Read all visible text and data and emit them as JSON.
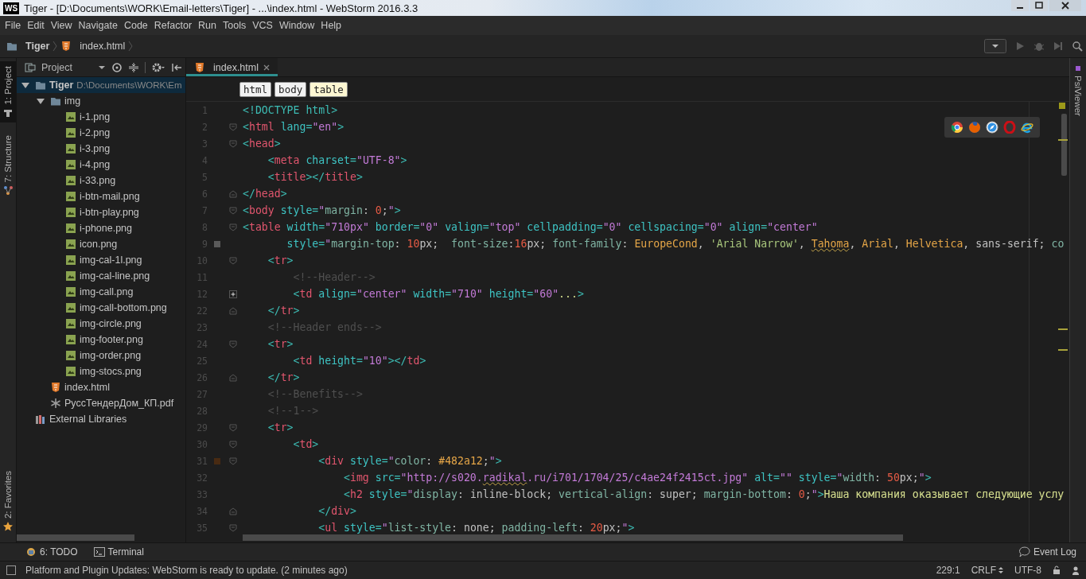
{
  "window": {
    "title": "Tiger - [D:\\Documents\\WORK\\Email-letters\\Tiger] - ...\\index.html - WebStorm 2016.3.3",
    "badge": "WS"
  },
  "menu": [
    "File",
    "Edit",
    "View",
    "Navigate",
    "Code",
    "Refactor",
    "Run",
    "Tools",
    "VCS",
    "Window",
    "Help"
  ],
  "navigation": {
    "breadcrumbs": [
      {
        "label": "Tiger",
        "kind": "folder"
      },
      {
        "label": "index.html",
        "kind": "html"
      }
    ]
  },
  "left_tool_strip": {
    "top": [
      {
        "label": "1: Project",
        "kind": "project",
        "selected": true
      },
      {
        "label": "7: Structure",
        "kind": "structure",
        "selected": false
      }
    ],
    "bottom": [
      {
        "label": "2: Favorites",
        "kind": "favorites",
        "selected": false
      }
    ]
  },
  "project_panel": {
    "title": "Project",
    "tree": [
      {
        "label": "Tiger",
        "kind": "project",
        "path": "D:\\Documents\\WORK\\Em",
        "expanded": true,
        "selected": true,
        "children": [
          {
            "label": "img",
            "kind": "folder",
            "expanded": true,
            "selected": false,
            "children": [
              {
                "label": "i-1.png",
                "kind": "image",
                "selected": false
              },
              {
                "label": "i-2.png",
                "kind": "image",
                "selected": false
              },
              {
                "label": "i-3.png",
                "kind": "image",
                "selected": false
              },
              {
                "label": "i-4.png",
                "kind": "image",
                "selected": false
              },
              {
                "label": "i-33.png",
                "kind": "image",
                "selected": false
              },
              {
                "label": "i-btn-mail.png",
                "kind": "image",
                "selected": false
              },
              {
                "label": "i-btn-play.png",
                "kind": "image",
                "selected": false
              },
              {
                "label": "i-phone.png",
                "kind": "image",
                "selected": false
              },
              {
                "label": "icon.png",
                "kind": "image",
                "selected": false
              },
              {
                "label": "img-cal-1l.png",
                "kind": "image",
                "selected": false
              },
              {
                "label": "img-cal-line.png",
                "kind": "image",
                "selected": false
              },
              {
                "label": "img-call.png",
                "kind": "image",
                "selected": false
              },
              {
                "label": "img-call-bottom.png",
                "kind": "image",
                "selected": false
              },
              {
                "label": "img-circle.png",
                "kind": "image",
                "selected": false
              },
              {
                "label": "img-footer.png",
                "kind": "image",
                "selected": false
              },
              {
                "label": "img-order.png",
                "kind": "image",
                "selected": false
              },
              {
                "label": "img-stocs.png",
                "kind": "image",
                "selected": false
              }
            ]
          },
          {
            "label": "index.html",
            "kind": "html",
            "selected": false
          },
          {
            "label": "РуссТендерДом_КП.pdf",
            "kind": "pdf",
            "selected": false
          }
        ]
      },
      {
        "label": "External Libraries",
        "kind": "library",
        "selected": false
      }
    ]
  },
  "editor": {
    "tabs": [
      {
        "label": "index.html",
        "kind": "html",
        "selected": true
      }
    ],
    "breadcrumbs": [
      {
        "label": "html",
        "selected": false
      },
      {
        "label": "body",
        "selected": false
      },
      {
        "label": "table",
        "selected": true
      }
    ],
    "lines": [
      {
        "number": "1",
        "tokens": [
          {
            "kind": "p",
            "text": "<!DOCTYPE html>"
          }
        ]
      },
      {
        "number": "2",
        "fold": {
          "kind": "open"
        },
        "tokens": [
          {
            "kind": "p",
            "text": "<"
          },
          {
            "kind": "t",
            "text": "html"
          },
          {
            "kind": "a",
            "text": " lang"
          },
          {
            "kind": "p",
            "text": "="
          },
          {
            "kind": "v",
            "text": "\"en\""
          },
          {
            "kind": "p",
            "text": ">"
          }
        ]
      },
      {
        "number": "3",
        "fold": {
          "kind": "open"
        },
        "tokens": [
          {
            "kind": "p",
            "text": "<"
          },
          {
            "kind": "t",
            "text": "head"
          },
          {
            "kind": "p",
            "text": ">"
          }
        ]
      },
      {
        "number": "4",
        "tokens": [
          {
            "kind": "p",
            "text": "    <"
          },
          {
            "kind": "t",
            "text": "meta"
          },
          {
            "kind": "a",
            "text": " charset"
          },
          {
            "kind": "p",
            "text": "="
          },
          {
            "kind": "v",
            "text": "\"UTF-8\""
          },
          {
            "kind": "p",
            "text": ">"
          }
        ]
      },
      {
        "number": "5",
        "tokens": [
          {
            "kind": "p",
            "text": "    <"
          },
          {
            "kind": "t",
            "text": "title"
          },
          {
            "kind": "p",
            "text": "></"
          },
          {
            "kind": "t",
            "text": "title"
          },
          {
            "kind": "p",
            "text": ">"
          }
        ]
      },
      {
        "number": "6",
        "fold": {
          "kind": "close"
        },
        "tokens": [
          {
            "kind": "p",
            "text": "</"
          },
          {
            "kind": "t",
            "text": "head"
          },
          {
            "kind": "p",
            "text": ">"
          }
        ]
      },
      {
        "number": "7",
        "fold": {
          "kind": "open"
        },
        "tokens": [
          {
            "kind": "p",
            "text": "<"
          },
          {
            "kind": "t",
            "text": "body"
          },
          {
            "kind": "a",
            "text": " style"
          },
          {
            "kind": "p",
            "text": "="
          },
          {
            "kind": "v",
            "text": "\""
          },
          {
            "kind": "k",
            "text": "margin"
          },
          {
            "kind": "x",
            "text": ": "
          },
          {
            "kind": "n",
            "text": "0"
          },
          {
            "kind": "x",
            "text": ";"
          },
          {
            "kind": "v",
            "text": "\""
          },
          {
            "kind": "p",
            "text": ">"
          }
        ]
      },
      {
        "number": "8",
        "fold": {
          "kind": "open"
        },
        "tokens": [
          {
            "kind": "p",
            "text": "<"
          },
          {
            "kind": "t",
            "text": "table"
          },
          {
            "kind": "a",
            "text": " width"
          },
          {
            "kind": "p",
            "text": "="
          },
          {
            "kind": "v",
            "text": "\"710px\""
          },
          {
            "kind": "a",
            "text": " border"
          },
          {
            "kind": "p",
            "text": "="
          },
          {
            "kind": "v",
            "text": "\"0\""
          },
          {
            "kind": "a",
            "text": " valign"
          },
          {
            "kind": "p",
            "text": "="
          },
          {
            "kind": "v",
            "text": "\"top\""
          },
          {
            "kind": "a",
            "text": " cellpadding"
          },
          {
            "kind": "p",
            "text": "="
          },
          {
            "kind": "v",
            "text": "\"0\""
          },
          {
            "kind": "a",
            "text": " cellspacing"
          },
          {
            "kind": "p",
            "text": "="
          },
          {
            "kind": "v",
            "text": "\"0\""
          },
          {
            "kind": "a",
            "text": " align"
          },
          {
            "kind": "p",
            "text": "="
          },
          {
            "kind": "v",
            "text": "\"center\""
          }
        ]
      },
      {
        "number": "9",
        "color": "#5a5a5a",
        "tokens": [
          {
            "kind": "a",
            "text": "       style"
          },
          {
            "kind": "p",
            "text": "="
          },
          {
            "kind": "v",
            "text": "\""
          },
          {
            "kind": "k",
            "text": "margin-top"
          },
          {
            "kind": "x",
            "text": ": "
          },
          {
            "kind": "n",
            "text": "10"
          },
          {
            "kind": "x",
            "text": "px;  "
          },
          {
            "kind": "k",
            "text": "font-size"
          },
          {
            "kind": "x",
            "text": ":"
          },
          {
            "kind": "n",
            "text": "16"
          },
          {
            "kind": "x",
            "text": "px; "
          },
          {
            "kind": "k",
            "text": "font-family"
          },
          {
            "kind": "x",
            "text": ": "
          },
          {
            "kind": "f",
            "text": "EuropeCond"
          },
          {
            "kind": "x",
            "text": ", "
          },
          {
            "kind": "s",
            "text": "'Arial Narrow'"
          },
          {
            "kind": "x",
            "text": ", "
          },
          {
            "kind": "w",
            "text": "Tahoma"
          },
          {
            "kind": "x",
            "text": ", "
          },
          {
            "kind": "f",
            "text": "Arial"
          },
          {
            "kind": "x",
            "text": ", "
          },
          {
            "kind": "f",
            "text": "Helvetica"
          },
          {
            "kind": "x",
            "text": ", sans-serif; "
          },
          {
            "kind": "k",
            "text": "co"
          }
        ]
      },
      {
        "number": "10",
        "fold": {
          "kind": "open"
        },
        "tokens": [
          {
            "kind": "p",
            "text": "    <"
          },
          {
            "kind": "t",
            "text": "tr"
          },
          {
            "kind": "p",
            "text": ">"
          }
        ]
      },
      {
        "number": "11",
        "tokens": [
          {
            "kind": "c",
            "text": "        <!--Header-->"
          }
        ]
      },
      {
        "number": "12",
        "fold": {
          "kind": "collapsed"
        },
        "tokens": [
          {
            "kind": "p",
            "text": "        <"
          },
          {
            "kind": "t",
            "text": "td"
          },
          {
            "kind": "a",
            "text": " align"
          },
          {
            "kind": "p",
            "text": "="
          },
          {
            "kind": "v",
            "text": "\"center\""
          },
          {
            "kind": "a",
            "text": " width"
          },
          {
            "kind": "p",
            "text": "="
          },
          {
            "kind": "v",
            "text": "\"710\""
          },
          {
            "kind": "a",
            "text": " height"
          },
          {
            "kind": "p",
            "text": "="
          },
          {
            "kind": "v",
            "text": "\"60\""
          },
          {
            "kind": "y",
            "text": "..."
          },
          {
            "kind": "p",
            "text": ">"
          }
        ]
      },
      {
        "number": "22",
        "fold": {
          "kind": "close"
        },
        "tokens": [
          {
            "kind": "p",
            "text": "    </"
          },
          {
            "kind": "t",
            "text": "tr"
          },
          {
            "kind": "p",
            "text": ">"
          }
        ]
      },
      {
        "number": "23",
        "tokens": [
          {
            "kind": "c",
            "text": "    <!--Header ends-->"
          }
        ]
      },
      {
        "number": "24",
        "fold": {
          "kind": "open"
        },
        "tokens": [
          {
            "kind": "p",
            "text": "    <"
          },
          {
            "kind": "t",
            "text": "tr"
          },
          {
            "kind": "p",
            "text": ">"
          }
        ]
      },
      {
        "number": "25",
        "tokens": [
          {
            "kind": "p",
            "text": "        <"
          },
          {
            "kind": "t",
            "text": "td"
          },
          {
            "kind": "a",
            "text": " height"
          },
          {
            "kind": "p",
            "text": "="
          },
          {
            "kind": "v",
            "text": "\"10\""
          },
          {
            "kind": "p",
            "text": "></"
          },
          {
            "kind": "t",
            "text": "td"
          },
          {
            "kind": "p",
            "text": ">"
          }
        ]
      },
      {
        "number": "26",
        "fold": {
          "kind": "close"
        },
        "tokens": [
          {
            "kind": "p",
            "text": "    </"
          },
          {
            "kind": "t",
            "text": "tr"
          },
          {
            "kind": "p",
            "text": ">"
          }
        ]
      },
      {
        "number": "27",
        "tokens": [
          {
            "kind": "c",
            "text": "    <!--Benefits-->"
          }
        ]
      },
      {
        "number": "28",
        "tokens": [
          {
            "kind": "c",
            "text": "    <!--1-->"
          }
        ]
      },
      {
        "number": "29",
        "fold": {
          "kind": "open"
        },
        "tokens": [
          {
            "kind": "p",
            "text": "    <"
          },
          {
            "kind": "t",
            "text": "tr"
          },
          {
            "kind": "p",
            "text": ">"
          }
        ]
      },
      {
        "number": "30",
        "fold": {
          "kind": "open"
        },
        "tokens": [
          {
            "kind": "p",
            "text": "        <"
          },
          {
            "kind": "t",
            "text": "td"
          },
          {
            "kind": "p",
            "text": ">"
          }
        ]
      },
      {
        "number": "31",
        "fold": {
          "kind": "open"
        },
        "color": "#482a12",
        "tokens": [
          {
            "kind": "p",
            "text": "            <"
          },
          {
            "kind": "t",
            "text": "div"
          },
          {
            "kind": "a",
            "text": " style"
          },
          {
            "kind": "p",
            "text": "="
          },
          {
            "kind": "v",
            "text": "\""
          },
          {
            "kind": "k",
            "text": "color"
          },
          {
            "kind": "x",
            "text": ": "
          },
          {
            "kind": "f",
            "text": "#482a12"
          },
          {
            "kind": "x",
            "text": ";"
          },
          {
            "kind": "v",
            "text": "\""
          },
          {
            "kind": "p",
            "text": ">"
          }
        ]
      },
      {
        "number": "32",
        "tokens": [
          {
            "kind": "p",
            "text": "                <"
          },
          {
            "kind": "t",
            "text": "img"
          },
          {
            "kind": "a",
            "text": " src"
          },
          {
            "kind": "p",
            "text": "="
          },
          {
            "kind": "v",
            "text": "\"http://s020."
          },
          {
            "kind": "u",
            "text": "radikal"
          },
          {
            "kind": "v",
            "text": ".ru/i701/1704/25/c4ae24f2415ct.jpg\""
          },
          {
            "kind": "a",
            "text": " alt"
          },
          {
            "kind": "p",
            "text": "="
          },
          {
            "kind": "v",
            "text": "\"\""
          },
          {
            "kind": "a",
            "text": " style"
          },
          {
            "kind": "p",
            "text": "="
          },
          {
            "kind": "v",
            "text": "\""
          },
          {
            "kind": "k",
            "text": "width"
          },
          {
            "kind": "x",
            "text": ": "
          },
          {
            "kind": "n",
            "text": "50"
          },
          {
            "kind": "x",
            "text": "px;"
          },
          {
            "kind": "v",
            "text": "\""
          },
          {
            "kind": "p",
            "text": ">"
          }
        ]
      },
      {
        "number": "33",
        "tokens": [
          {
            "kind": "p",
            "text": "                <"
          },
          {
            "kind": "t",
            "text": "h2"
          },
          {
            "kind": "a",
            "text": " style"
          },
          {
            "kind": "p",
            "text": "="
          },
          {
            "kind": "v",
            "text": "\""
          },
          {
            "kind": "k",
            "text": "display"
          },
          {
            "kind": "x",
            "text": ": inline-block; "
          },
          {
            "kind": "k",
            "text": "vertical-align"
          },
          {
            "kind": "x",
            "text": ": super; "
          },
          {
            "kind": "k",
            "text": "margin-bottom"
          },
          {
            "kind": "x",
            "text": ": "
          },
          {
            "kind": "n",
            "text": "0"
          },
          {
            "kind": "x",
            "text": ";"
          },
          {
            "kind": "v",
            "text": "\""
          },
          {
            "kind": "p",
            "text": ">"
          },
          {
            "kind": "y",
            "text": "Наша компания оказывает следующие услу"
          }
        ]
      },
      {
        "number": "34",
        "fold": {
          "kind": "close"
        },
        "tokens": [
          {
            "kind": "p",
            "text": "            </"
          },
          {
            "kind": "t",
            "text": "div"
          },
          {
            "kind": "p",
            "text": ">"
          }
        ]
      },
      {
        "number": "35",
        "fold": {
          "kind": "open"
        },
        "tokens": [
          {
            "kind": "p",
            "text": "            <"
          },
          {
            "kind": "t",
            "text": "ul"
          },
          {
            "kind": "a",
            "text": " style"
          },
          {
            "kind": "p",
            "text": "="
          },
          {
            "kind": "v",
            "text": "\""
          },
          {
            "kind": "k",
            "text": "list-style"
          },
          {
            "kind": "x",
            "text": ": none; "
          },
          {
            "kind": "k",
            "text": "padding-left"
          },
          {
            "kind": "x",
            "text": ": "
          },
          {
            "kind": "n",
            "text": "20"
          },
          {
            "kind": "x",
            "text": "px;"
          },
          {
            "kind": "v",
            "text": "\""
          },
          {
            "kind": "p",
            "text": ">"
          }
        ]
      }
    ]
  },
  "right_tool_strip": [
    {
      "label": "PsiViewer"
    }
  ],
  "bottom_tools": [
    {
      "label": "6: TODO",
      "kind": "todo"
    },
    {
      "label": "Terminal",
      "kind": "terminal"
    }
  ],
  "event_log": "Event Log",
  "status_bar": {
    "message": "Platform and Plugin Updates: WebStorm is ready to update. (2 minutes ago)",
    "position": "229:1",
    "line_separator": "CRLF",
    "encoding": "UTF-8"
  }
}
